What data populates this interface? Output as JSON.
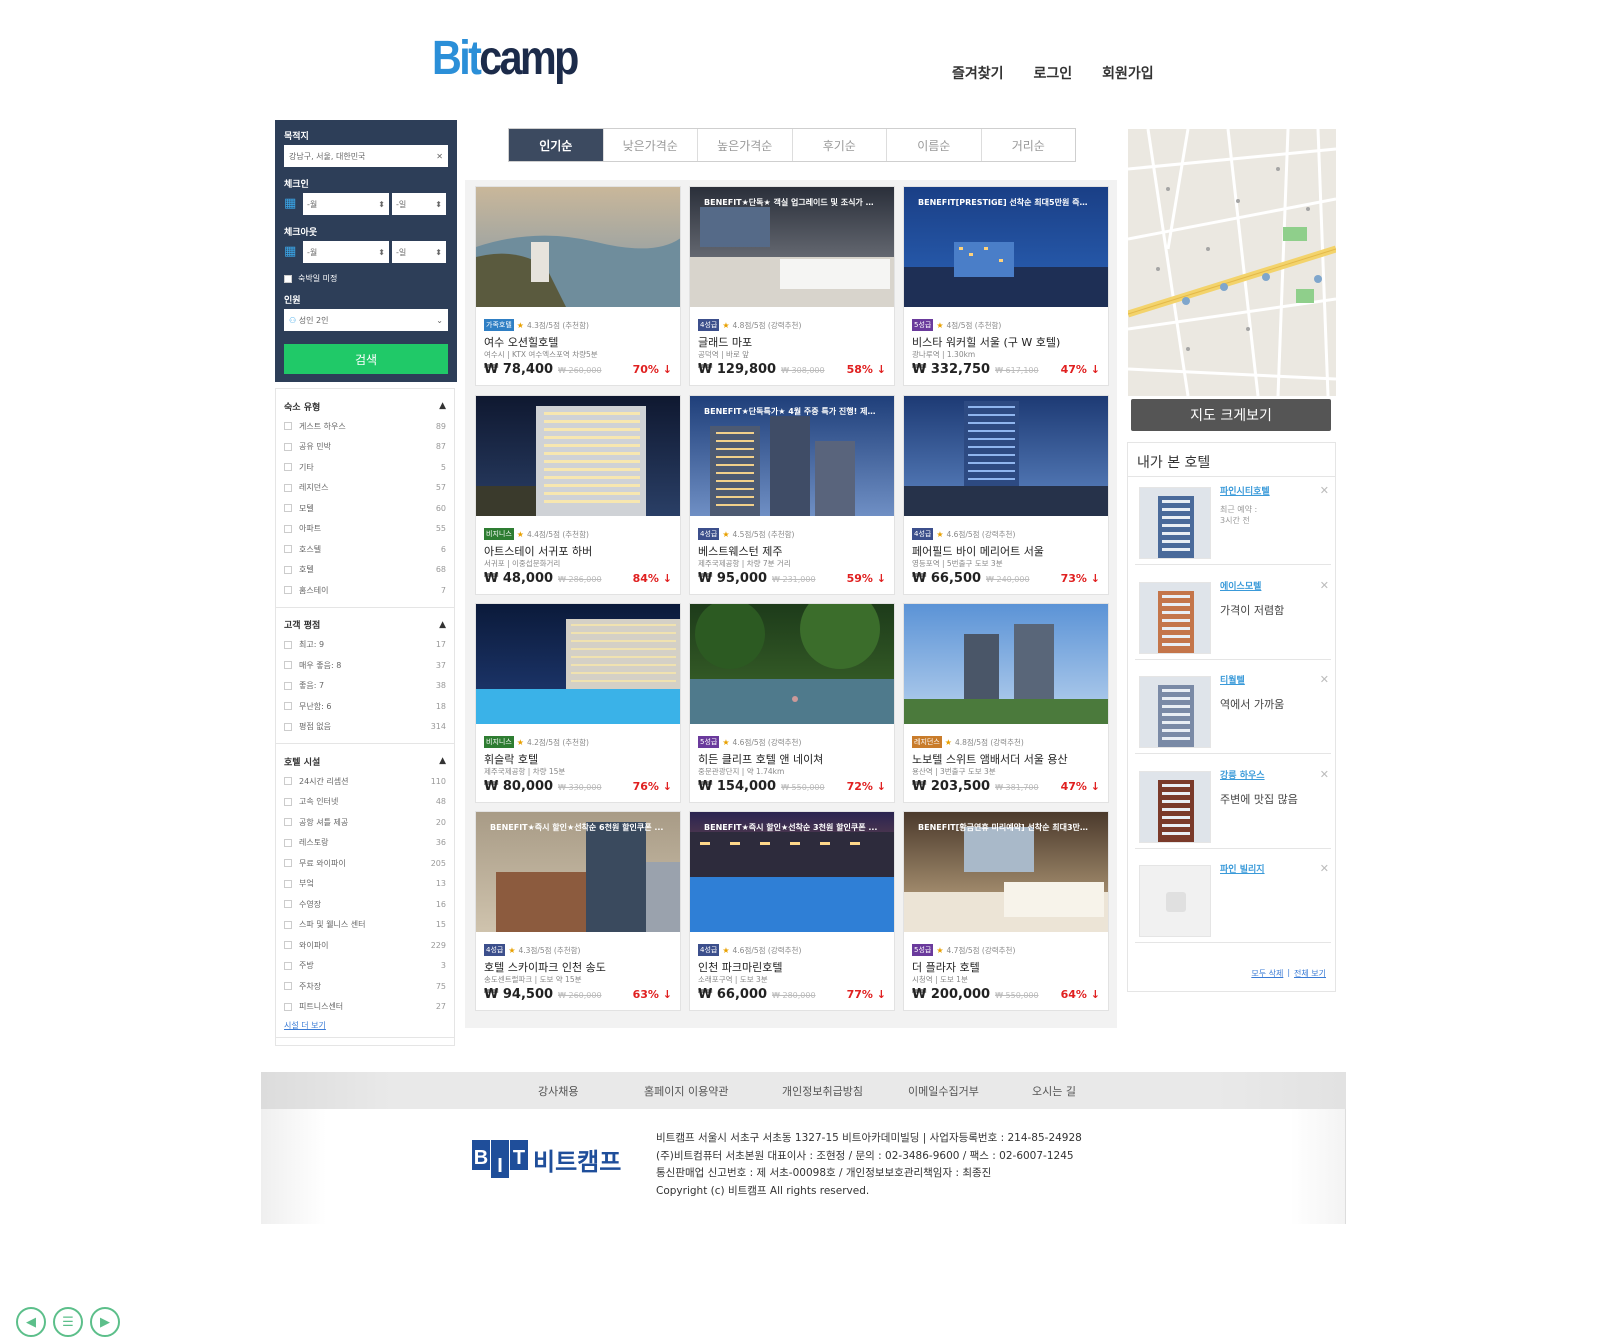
{
  "header": {
    "logo_part1": "Bit",
    "logo_part2": "camp",
    "nav": [
      "즐겨찾기",
      "로그인",
      "회원가입"
    ]
  },
  "search": {
    "destination_label": "목적지",
    "destination_value": "강남구, 서울, 대한민국",
    "checkin_label": "체크인",
    "checkout_label": "체크아웃",
    "month_placeholder": "-월",
    "day_placeholder": "-일",
    "undecided_label": "숙박일 미정",
    "guests_label": "인원",
    "guests_value": "성인 2인",
    "search_button": "검색"
  },
  "filters": [
    {
      "title": "숙소 유형",
      "items": [
        {
          "label": "게스트 하우스",
          "count": "89"
        },
        {
          "label": "공유 민박",
          "count": "87"
        },
        {
          "label": "기타",
          "count": "5"
        },
        {
          "label": "레지던스",
          "count": "57"
        },
        {
          "label": "모텔",
          "count": "60"
        },
        {
          "label": "아파트",
          "count": "55"
        },
        {
          "label": "호스텔",
          "count": "6"
        },
        {
          "label": "호텔",
          "count": "68"
        },
        {
          "label": "홈스테이",
          "count": "7"
        }
      ]
    },
    {
      "title": "고객 평점",
      "items": [
        {
          "label": "최고: 9",
          "count": "17"
        },
        {
          "label": "매우 좋음: 8",
          "count": "37"
        },
        {
          "label": "좋음: 7",
          "count": "38"
        },
        {
          "label": "무난함: 6",
          "count": "18"
        },
        {
          "label": "평점 없음",
          "count": "314"
        }
      ]
    },
    {
      "title": "호텔 시설",
      "items": [
        {
          "label": "24시간 리셉션",
          "count": "110"
        },
        {
          "label": "고속 인터넷",
          "count": "48"
        },
        {
          "label": "공항 셔틀 제공",
          "count": "20"
        },
        {
          "label": "레스토랑",
          "count": "36"
        },
        {
          "label": "무료 와이파이",
          "count": "205"
        },
        {
          "label": "부엌",
          "count": "13"
        },
        {
          "label": "수영장",
          "count": "16"
        },
        {
          "label": "스파 및 웰니스 센터",
          "count": "15"
        },
        {
          "label": "와이파이",
          "count": "229"
        },
        {
          "label": "주방",
          "count": "3"
        },
        {
          "label": "주차장",
          "count": "75"
        },
        {
          "label": "피트니스센터",
          "count": "27"
        }
      ]
    }
  ],
  "filters_more": "시설 더 보기",
  "sort_tabs": [
    "인기순",
    "낮은가격순",
    "높은가격순",
    "후기순",
    "이름순",
    "거리순"
  ],
  "hotels": [
    {
      "grade": "가족호텔",
      "grade_color": "#2f7fc4",
      "rating": "4.3점/5점 (추천함)",
      "name": "여수 오션힐호텔",
      "location": "여수시 | KTX 여수엑스포역 차량5분",
      "price": "₩ 78,400",
      "original": "₩ 260,000",
      "discount": "70% ↓",
      "benefit": "",
      "img": "coast"
    },
    {
      "grade": "4성급",
      "grade_color": "#3c4f8c",
      "rating": "4.8점/5점 (강력추천)",
      "name": "글래드 마포",
      "location": "공덕역 | 바로 앞",
      "price": "₩ 129,800",
      "original": "₩ 308,000",
      "discount": "58% ↓",
      "benefit": "BENEFIT★단독★ 객실 업그레이드 및 조식가 객...",
      "img": "room"
    },
    {
      "grade": "5성급",
      "grade_color": "#6a3a9c",
      "rating": "4점/5점 (추천함)",
      "name": "비스타 워커힐 서울 (구 W 호텔)",
      "location": "광나루역 | 1.30km",
      "price": "₩ 332,750",
      "original": "₩ 617,100",
      "discount": "47% ↓",
      "benefit": "BENEFIT[PRESTIGE] 선착순 최대5만원 즉시할...",
      "img": "nightblue"
    },
    {
      "grade": "비지니스",
      "grade_color": "#2e7d32",
      "rating": "4.4점/5점 (추천함)",
      "name": "아트스테이 서귀포 하버",
      "location": "서귀포 | 이중섭문화거리",
      "price": "₩ 48,000",
      "original": "₩ 286,000",
      "discount": "84% ↓",
      "benefit": "",
      "img": "tower"
    },
    {
      "grade": "4성급",
      "grade_color": "#3c4f8c",
      "rating": "4.5점/5점 (추천함)",
      "name": "베스트웨스턴 제주",
      "location": "제주국제공항 | 차량 7분 거리",
      "price": "₩ 95,000",
      "original": "₩ 231,000",
      "discount": "59% ↓",
      "benefit": "BENEFIT★단독특가★ 4월 주중 특가 진행! 제주...",
      "img": "dusk"
    },
    {
      "grade": "4성급",
      "grade_color": "#3c4f8c",
      "rating": "4.6점/5점 (강력추천)",
      "name": "페어필드 바이 메리어트 서울",
      "location": "영등포역 | 5번출구 도보 3분",
      "price": "₩ 66,500",
      "original": "₩ 240,000",
      "discount": "73% ↓",
      "benefit": "",
      "img": "citynight"
    },
    {
      "grade": "비지니스",
      "grade_color": "#2e7d32",
      "rating": "4.2점/5점 (추천함)",
      "name": "휘슬락 호텔",
      "location": "제주국제공항 | 차량 15분",
      "price": "₩ 80,000",
      "original": "₩ 330,000",
      "discount": "76% ↓",
      "benefit": "",
      "img": "pool"
    },
    {
      "grade": "5성급",
      "grade_color": "#6a3a9c",
      "rating": "4.6점/5점 (강력추천)",
      "name": "히든 클리프 호텔 앤 네이쳐",
      "location": "중문관광단지 | 약 1.74km",
      "price": "₩ 154,000",
      "original": "₩ 550,000",
      "discount": "72% ↓",
      "benefit": "",
      "img": "forest"
    },
    {
      "grade": "레지던스",
      "grade_color": "#c97c2b",
      "rating": "4.8점/5점 (강력추천)",
      "name": "노보텔 스위트 앰배서더 서울 용산",
      "location": "용산역 | 3번출구 도보 3분",
      "price": "₩ 203,500",
      "original": "₩ 381,700",
      "discount": "47% ↓",
      "benefit": "",
      "img": "sky"
    },
    {
      "grade": "4성급",
      "grade_color": "#3c4f8c",
      "rating": "4.3점/5점 (추천함)",
      "name": "호텔 스카이파크 인천 송도",
      "location": "송도센트럴파크 | 도보 약 15분",
      "price": "₩ 94,500",
      "original": "₩ 260,000",
      "discount": "63% ↓",
      "benefit": "BENEFIT★즉시 할인★선착순 6천원 할인쿠폰 ...",
      "img": "daytower"
    },
    {
      "grade": "4성급",
      "grade_color": "#3c4f8c",
      "rating": "4.6점/5점 (강력추천)",
      "name": "인천 파크마린호텔",
      "location": "소래포구역 | 도보 3분",
      "price": "₩ 66,000",
      "original": "₩ 280,000",
      "discount": "77% ↓",
      "benefit": "BENEFIT★즉시 할인★선착순 3천원 할인쿠폰 ...",
      "img": "sunsetpool"
    },
    {
      "grade": "5성급",
      "grade_color": "#6a3a9c",
      "rating": "4.7점/5점 (강력추천)",
      "name": "더 플라자 호텔",
      "location": "시청역 | 도보 1분",
      "price": "₩ 200,000",
      "original": "₩ 550,000",
      "discount": "64% ↓",
      "benefit": "BENEFIT[황금연휴 미리예약] 선착순 최대3만원 ...",
      "img": "suite"
    }
  ],
  "map_button": "지도 크게보기",
  "recent": {
    "title": "내가 본 호텔",
    "items": [
      {
        "name": "파인시티호텔",
        "desc": "",
        "small1": "최근 예약 :",
        "small2": "3시간 전"
      },
      {
        "name": "에이스모텔",
        "desc": "가격이 저렴함",
        "small1": "",
        "small2": ""
      },
      {
        "name": "티월텔",
        "desc": "역에서 가까움",
        "small1": "",
        "small2": ""
      },
      {
        "name": "강릉 하우스",
        "desc": "주변에 맛집 많음",
        "small1": "",
        "small2": ""
      },
      {
        "name": "파인 빌리지",
        "desc": "",
        "small1": "",
        "small2": ""
      }
    ],
    "delete_all": "모두 삭제",
    "view_all": "전체 보기",
    "separator": "|"
  },
  "footer": {
    "links": [
      "강사채용",
      "홈페이지 이용약관",
      "개인정보취급방침",
      "이메일수집거부",
      "오시는 길"
    ],
    "logo_letters": [
      "B",
      "I",
      "T"
    ],
    "logo_name": "비트캠프",
    "info": [
      "비트캠프 서울시 서초구 서초동 1327-15 비트아카데미빌딩 |  사업자등록번호 : 214-85-24928",
      "(주)비트컴퓨터 서초본원 대표이사 : 조현정 / 문의 : 02-3486-9600 / 팩스 : 02-6007-1245",
      "통신판매업 신고번호 : 제 서초-00098호 / 개인정보보호관리책임자 : 최종진",
      "Copyright (c) 비트캠프 All rights reserved."
    ]
  },
  "controls": {
    "prev_icon": "prev-circle-icon",
    "menu_icon": "menu-circle-icon",
    "next_icon": "next-circle-icon"
  }
}
